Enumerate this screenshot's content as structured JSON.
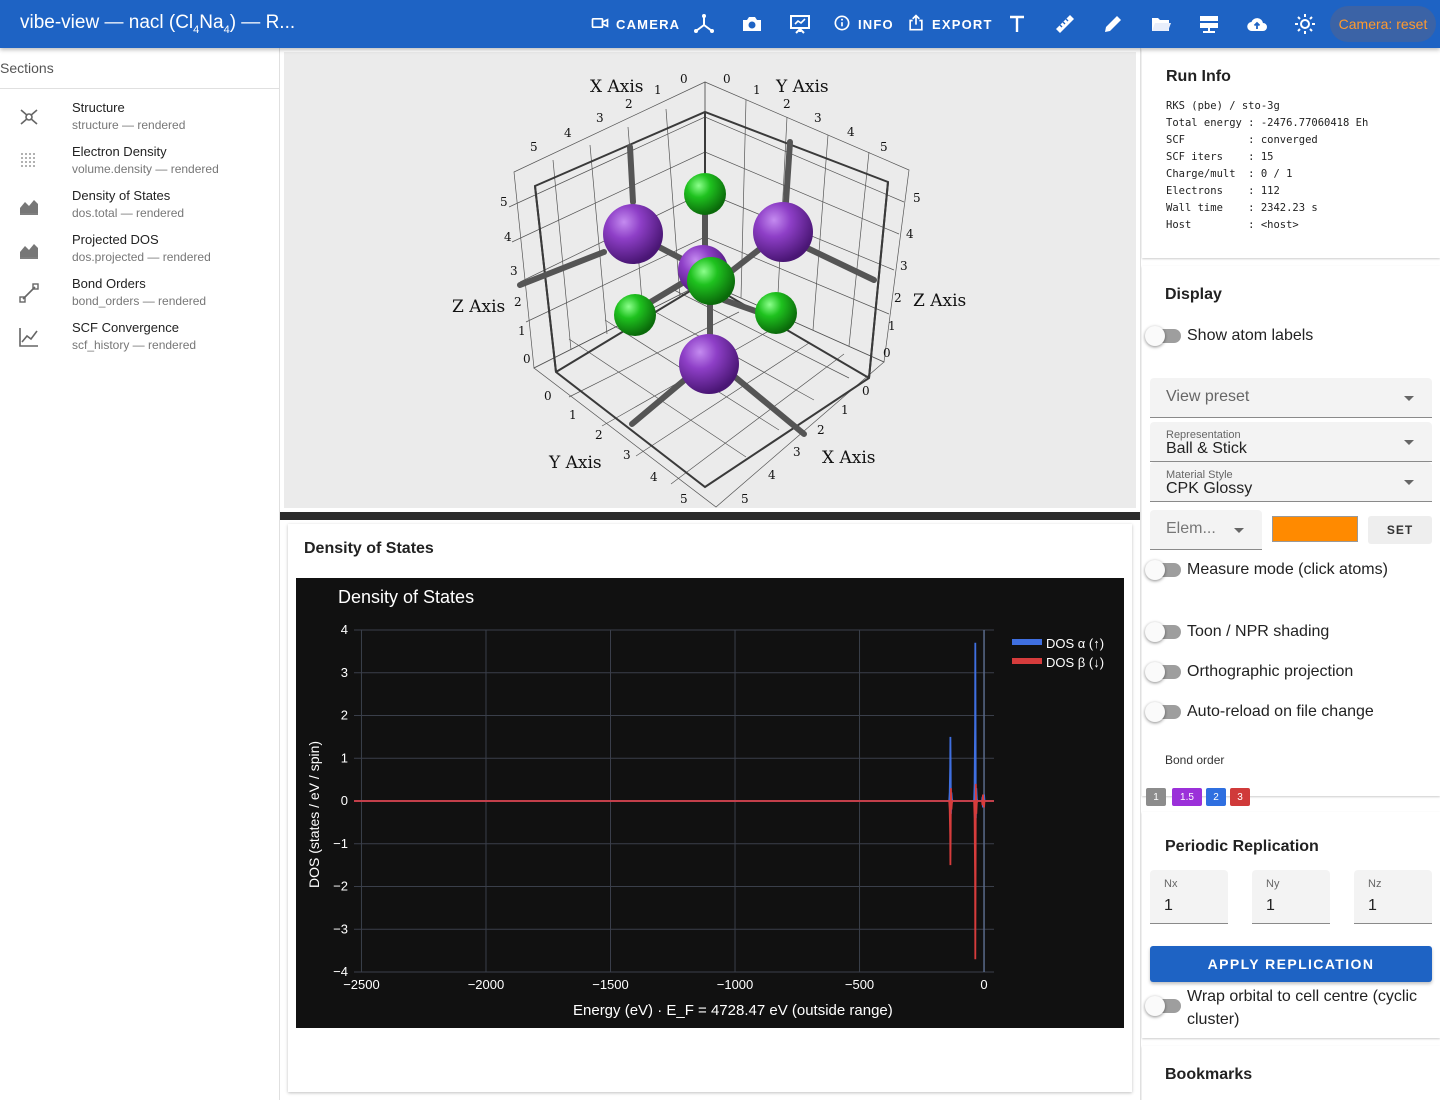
{
  "app": {
    "title_prefix": "vibe-view — nacl (Cl",
    "title_sub1": "4",
    "title_mid": "Na",
    "title_sub2": "4",
    "title_suffix": ") — R..."
  },
  "toolbar": {
    "camera_label": "CAMERA",
    "info_label": "INFO",
    "export_label": "EXPORT",
    "camera_reset_label": "Camera: reset",
    "accent": "#1e63c4",
    "reset_color": "#ff9a2e"
  },
  "sidebar": {
    "header": "Sections",
    "items": [
      {
        "title": "Structure",
        "sub": "structure — rendered",
        "icon": "molecule-icon"
      },
      {
        "title": "Electron Density",
        "sub": "volume.density — rendered",
        "icon": "grid-dots-icon"
      },
      {
        "title": "Density of States",
        "sub": "dos.total — rendered",
        "icon": "area-chart-icon"
      },
      {
        "title": "Projected DOS",
        "sub": "dos.projected — rendered",
        "icon": "area-chart-icon"
      },
      {
        "title": "Bond Orders",
        "sub": "bond_orders — rendered",
        "icon": "bond-icon"
      },
      {
        "title": "SCF Convergence",
        "sub": "scf_history — rendered",
        "icon": "line-chart-icon"
      }
    ]
  },
  "viewer": {
    "axis_x": "X Axis",
    "axis_y": "Y Axis",
    "axis_z": "Z Axis",
    "ticks": [
      "0",
      "1",
      "2",
      "3",
      "4",
      "5"
    ],
    "na_color": "#8e3fc7",
    "cl_color": "#1fc21f"
  },
  "dos_panel": {
    "card_title": "Density of States",
    "plot_title": "Density of States",
    "xlabel": "Energy (eV)  ·  E_F = 4728.47 eV (outside range)",
    "ylabel": "DOS (states / eV / spin)",
    "legend": [
      "DOS α (↑)",
      "DOS β (↓)"
    ]
  },
  "chart_data": {
    "type": "line",
    "title": "Density of States",
    "xlabel": "Energy (eV)  ·  E_F = 4728.47 eV (outside range)",
    "ylabel": "DOS (states / eV / spin)",
    "xlim": [
      -2530,
      40
    ],
    "ylim": [
      -4,
      4
    ],
    "x_ticks": [
      -2500,
      -2000,
      -1500,
      -1000,
      -500,
      0
    ],
    "x_tick_labels": [
      "−2500",
      "−2000",
      "−1500",
      "−1000",
      "−500",
      "0"
    ],
    "y_ticks": [
      4,
      3,
      2,
      1,
      0,
      -1,
      -2,
      -3,
      -4
    ],
    "y_tick_labels": [
      "4",
      "3",
      "2",
      "1",
      "0",
      "−1",
      "−2",
      "−3",
      "−4"
    ],
    "grid": true,
    "legend_position": "top-right",
    "series": [
      {
        "name": "DOS α (↑)",
        "color": "#3f6fe0",
        "x": [
          -2530,
          -140,
          -138,
          -136,
          -135,
          -134,
          -133,
          -131,
          -129,
          -127,
          -125,
          -40,
          -38,
          -36,
          -35,
          -34,
          -33,
          -31,
          -29,
          -27,
          -25,
          -8,
          -6,
          -4,
          0,
          2,
          40
        ],
        "y": [
          0,
          0,
          0.2,
          0.8,
          1.5,
          0.7,
          -0.3,
          0.2,
          0.05,
          0,
          0,
          0,
          0.4,
          1.8,
          3.7,
          1.5,
          -0.4,
          0.3,
          0.05,
          0,
          0,
          0,
          0.1,
          -0.15,
          0.15,
          0,
          0
        ]
      },
      {
        "name": "DOS β (↓)",
        "color": "#d63c3c",
        "x": [
          -2530,
          -140,
          -138,
          -136,
          -135,
          -134,
          -133,
          -131,
          -129,
          -127,
          -125,
          -40,
          -38,
          -36,
          -35,
          -34,
          -33,
          -31,
          -29,
          -27,
          -25,
          -8,
          -6,
          -4,
          0,
          2,
          40
        ],
        "y": [
          0,
          0,
          -0.2,
          -0.8,
          -1.5,
          -0.7,
          0.3,
          -0.2,
          -0.05,
          0,
          0,
          0,
          -0.4,
          -1.8,
          -3.7,
          -1.5,
          0.4,
          -0.3,
          -0.05,
          0,
          0,
          0,
          -0.1,
          0.15,
          -0.15,
          0,
          0
        ]
      }
    ],
    "fermi_line_x": 0
  },
  "run_info": {
    "title": "Run Info",
    "lines": [
      "RKS (pbe) / sto-3g",
      "Total energy : -2476.77060418 Eh",
      "SCF          : converged",
      "SCF iters    : 15",
      "Charge/mult  : 0 / 1",
      "Electrons    : 112",
      "Wall time    : 2342.23 s",
      "Host         : <host>"
    ]
  },
  "display": {
    "title": "Display",
    "show_atom_labels": "Show atom labels",
    "view_preset": "View preset",
    "representation_label": "Representation",
    "representation_value": "Ball & Stick",
    "material_label": "Material Style",
    "material_value": "CPK Glossy",
    "element_placeholder": "Elem...",
    "element_color": "#ff8a00",
    "set_label": "SET",
    "measure_mode": "Measure mode (click atoms)",
    "toon_shading": "Toon / NPR shading",
    "ortho": "Orthographic projection",
    "auto_reload": "Auto-reload on file change",
    "bond_order_label": "Bond order",
    "bond_orders": [
      {
        "label": "1",
        "color": "#8c8c8c"
      },
      {
        "label": "1.5",
        "color": "#9b30d9"
      },
      {
        "label": "2",
        "color": "#2f6fe0"
      },
      {
        "label": "3",
        "color": "#d03a3a"
      }
    ]
  },
  "replication": {
    "title": "Periodic Replication",
    "nx_label": "Nx",
    "nx": "1",
    "ny_label": "Ny",
    "ny": "1",
    "nz_label": "Nz",
    "nz": "1",
    "apply_label": "APPLY REPLICATION",
    "wrap_label": "Wrap orbital to cell centre (cyclic cluster)"
  },
  "bookmarks": {
    "title": "Bookmarks"
  }
}
